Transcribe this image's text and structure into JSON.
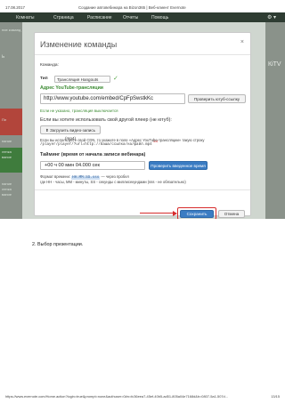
{
  "page": {
    "header_date": "17.08.2017",
    "header_title": "Создание автовебинара на Bizon365 | Веб-клиент Evernote",
    "footer_url": "https://www.evernote.com/Home.action?login=true&prompt=none&authuser=0#n=fc36eea7-45ef-40b5-ad51-805a04e7168d&b=0807-5a1-507d...",
    "footer_page": "13/15"
  },
  "topnav": {
    "items": [
      "Комнаты",
      "Страница",
      "Расписание",
      "Отчеты",
      "Помощь"
    ],
    "gear": "⚙ ▾"
  },
  "background": {
    "left_texts": [
      "ь",
      "ние команд",
      "Пл",
      "пание",
      "ленка",
      "вание",
      "пание",
      "ленка",
      "вание"
    ],
    "right_text": "КіТV"
  },
  "modal": {
    "title": "Изменение команды",
    "close": "×",
    "command_label": "Команда:",
    "type_label": "Тип",
    "type_value": "Трансляция Hangouts",
    "youtube_label": "Адрес YouTube-трансляции",
    "youtube_url": "http://www.youtube.com/embed/CpFpSwstkKc",
    "check_button": "Проверить ютуб-ссылку",
    "check_status": "Если не указано, трансляция выключается",
    "other_player_label": "Если вы хотите использовать свой другой плеер (не ютуб):",
    "upload_button": "Загрузить видео-запись (mp4)",
    "cdn_note": "Если вы используете свой CDN, то укажите в поле «Адрес YouTube-трансляции» такую строку",
    "cdn_example": "/player/player/?url=http://ваша/ссылка/на/файл.mp4",
    "red_note": "3/6",
    "timing_label": "Тайминг (время от начала записи вебинара)",
    "time_value": "+00 ч  00 мин  04.000 сек",
    "check_time_button": "Проверить введенное время",
    "format_prefix": "Формат времени:",
    "format_highlight": "HH:MM:SS.sss",
    "format_suffix": "— через пробел",
    "format_desc": "где HH - часы, MM - минуты, SS - секунды с миллисекундами (sss - не обязательно)",
    "save_button": "Сохранить",
    "cancel_button": "Отмена"
  },
  "document": {
    "item_text": "2. Выбор презентации."
  }
}
